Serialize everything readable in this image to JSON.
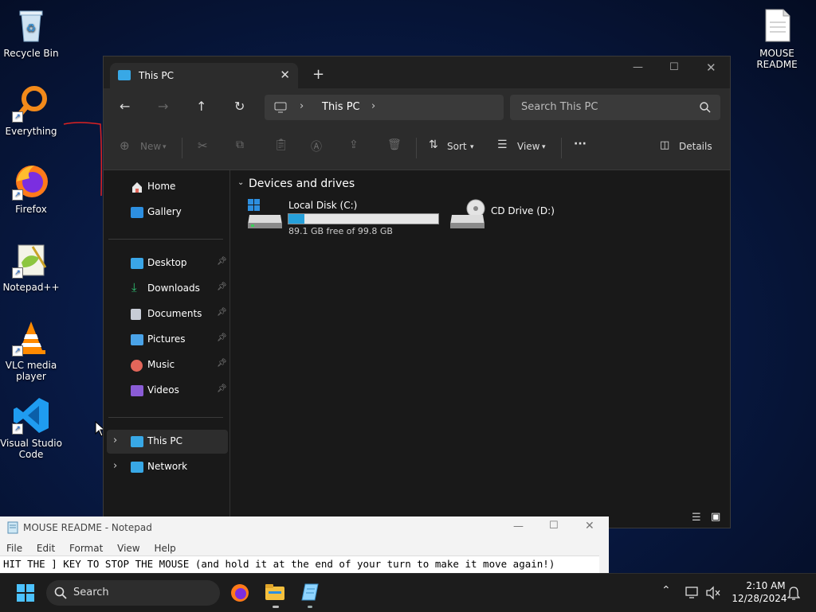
{
  "desktop": {
    "icons": [
      {
        "label": "Recycle Bin",
        "icon": "recycle-bin-icon"
      },
      {
        "label": "Everything",
        "icon": "magnifier-icon"
      },
      {
        "label": "Firefox",
        "icon": "firefox-icon"
      },
      {
        "label": "Notepad++",
        "icon": "notepadpp-icon"
      },
      {
        "label": "VLC media player",
        "icon": "vlc-cone-icon"
      },
      {
        "label": "Visual Studio Code",
        "icon": "vscode-icon"
      },
      {
        "label": "MOUSE README",
        "icon": "text-file-icon"
      }
    ]
  },
  "explorer": {
    "tab_title": "This PC",
    "new_tab": "+",
    "breadcrumb": {
      "location": "This PC"
    },
    "search_placeholder": "Search This PC",
    "commands": {
      "new": "New",
      "sort": "Sort",
      "view": "View",
      "more": "···",
      "details": "Details"
    },
    "sidebar": {
      "top": [
        {
          "label": "Home",
          "icon": "home-icon",
          "color": "#e8e8e8"
        },
        {
          "label": "Gallery",
          "icon": "gallery-icon",
          "color": "#2d8fe0"
        }
      ],
      "pinned": [
        {
          "label": "Desktop",
          "icon": "desktop-folder-icon",
          "color": "#3aa6e8"
        },
        {
          "label": "Downloads",
          "icon": "downloads-icon",
          "color": "#2fbf71"
        },
        {
          "label": "Documents",
          "icon": "documents-icon",
          "color": "#c7ccd6"
        },
        {
          "label": "Pictures",
          "icon": "pictures-icon",
          "color": "#4aa3e8"
        },
        {
          "label": "Music",
          "icon": "music-icon",
          "color": "#e2665a"
        },
        {
          "label": "Videos",
          "icon": "videos-icon",
          "color": "#8a5cd6"
        }
      ],
      "bottom": [
        {
          "label": "This PC",
          "icon": "this-pc-icon",
          "color": "#38a8e6",
          "selected": true
        },
        {
          "label": "Network",
          "icon": "network-icon",
          "color": "#38a8e6",
          "selected": false
        }
      ]
    },
    "section_title": "Devices and drives",
    "drives": [
      {
        "name": "Local Disk (C:)",
        "free_text": "89.1 GB free of 99.8 GB",
        "used_fraction": 0.107
      },
      {
        "name": "CD Drive (D:)"
      }
    ]
  },
  "notepad": {
    "title": "MOUSE README - Notepad",
    "menu": [
      "File",
      "Edit",
      "Format",
      "View",
      "Help"
    ],
    "text": "HIT THE ] KEY TO STOP THE MOUSE (and hold it at the end of your turn to make it move again!)"
  },
  "taskbar": {
    "search_label": "Search",
    "time": "2:10 AM",
    "date": "12/28/2024"
  },
  "colors": {
    "accent": "#0078d4",
    "drive_bar": "#26a0da"
  }
}
